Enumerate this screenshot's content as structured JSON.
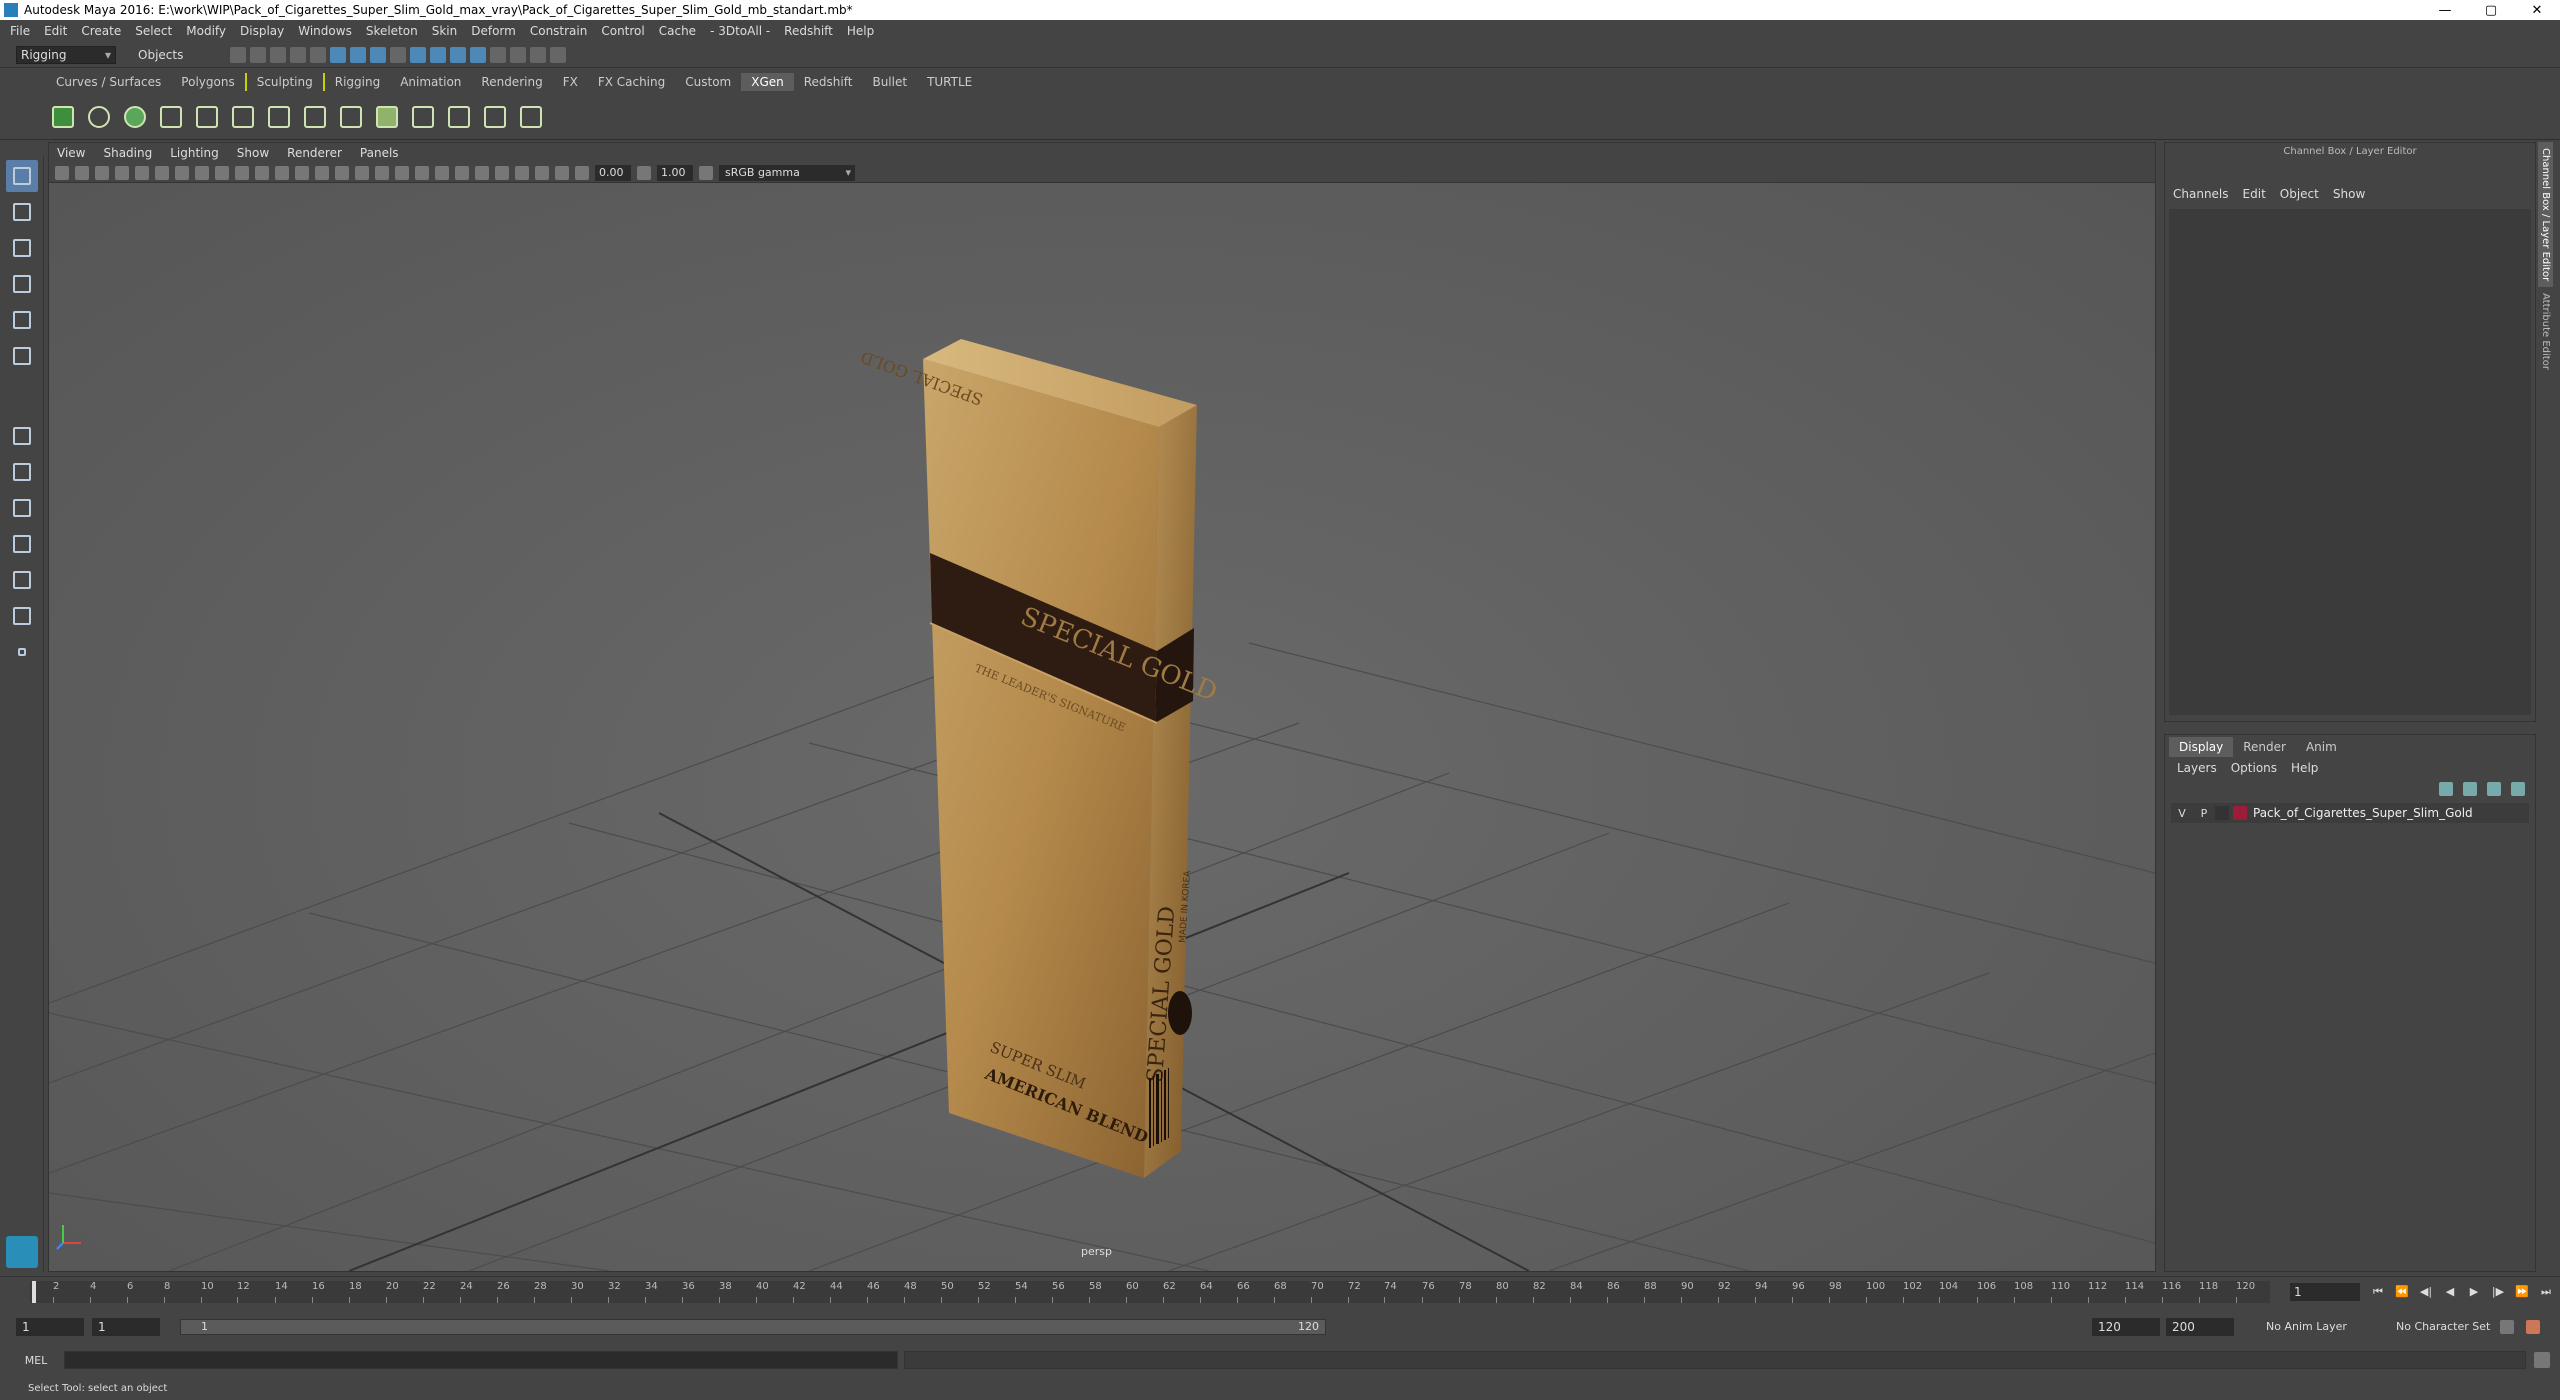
{
  "window": {
    "title": "Autodesk Maya 2016: E:\\work\\WIP\\Pack_of_Cigarettes_Super_Slim_Gold_max_vray\\Pack_of_Cigarettes_Super_Slim_Gold_mb_standart.mb*",
    "min": "—",
    "max": "▢",
    "close": "✕"
  },
  "menubar": [
    "File",
    "Edit",
    "Create",
    "Select",
    "Modify",
    "Display",
    "Windows",
    "Skeleton",
    "Skin",
    "Deform",
    "Constrain",
    "Control",
    "Cache",
    "- 3DtoAll -",
    "Redshift",
    "Help"
  ],
  "status": {
    "mode": "Rigging",
    "objects": "Objects"
  },
  "shelf_tabs": [
    "Curves / Surfaces",
    "Polygons",
    "Sculpting",
    "Rigging",
    "Animation",
    "Rendering",
    "FX",
    "FX Caching",
    "Custom",
    "XGen",
    "Redshift",
    "Bullet",
    "TURTLE"
  ],
  "shelf_active": "XGen",
  "panel": {
    "menu": [
      "View",
      "Shading",
      "Lighting",
      "Show",
      "Renderer",
      "Panels"
    ],
    "exposure": "0.00",
    "gamma": "1.00",
    "colorspace": "sRGB gamma",
    "camera": "persp"
  },
  "product": {
    "brand_top": "SPECIAL GOLD",
    "band_text": "SPECIAL GOLD",
    "tagline": "THE LEADER'S SIGNATURE",
    "sub1": "SUPER SLIM",
    "sub2": "AMERICAN BLEND",
    "side_brand": "SPECIAL GOLD",
    "side_small": "MADE IN KOREA"
  },
  "channel_box": {
    "header": "Channel Box / Layer Editor",
    "menu": [
      "Channels",
      "Edit",
      "Object",
      "Show"
    ]
  },
  "layer_editor": {
    "tabs": [
      "Display",
      "Render",
      "Anim"
    ],
    "menu": [
      "Layers",
      "Options",
      "Help"
    ],
    "layer": {
      "v": "V",
      "p": "P",
      "name": "Pack_of_Cigarettes_Super_Slim_Gold",
      "color": "#9c1d3a"
    }
  },
  "side_tabs": [
    "Channel Box / Layer Editor",
    "Attribute Editor"
  ],
  "timeline": {
    "ticks": [
      "2",
      "4",
      "6",
      "8",
      "10",
      "12",
      "14",
      "16",
      "18",
      "20",
      "22",
      "24",
      "26",
      "28",
      "30",
      "32",
      "34",
      "36",
      "38",
      "40",
      "42",
      "44",
      "46",
      "48",
      "50",
      "52",
      "54",
      "56",
      "58",
      "60",
      "62",
      "64",
      "66",
      "68",
      "70",
      "72",
      "74",
      "76",
      "78",
      "80",
      "82",
      "84",
      "86",
      "88",
      "90",
      "92",
      "94",
      "96",
      "98",
      "100",
      "102",
      "104",
      "106",
      "108",
      "110",
      "112",
      "114",
      "116",
      "118",
      "120"
    ],
    "current_frame": "1",
    "playback": [
      "⏮",
      "⏪",
      "◀|",
      "◀",
      "▶",
      "|▶",
      "⏩",
      "⏭"
    ]
  },
  "range": {
    "start": "1",
    "start2": "1",
    "bar_start": "1",
    "bar_end": "120",
    "end": "120",
    "end2": "200",
    "anim_layer": "No Anim Layer",
    "char_set": "No Character Set"
  },
  "command": {
    "label": "MEL"
  },
  "help": "Select Tool: select an object"
}
